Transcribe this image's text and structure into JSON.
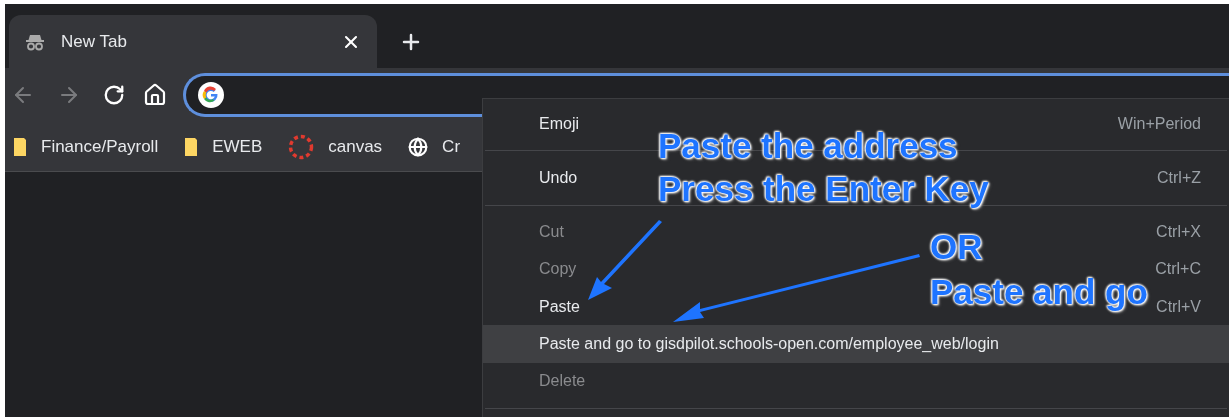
{
  "tab": {
    "title": "New Tab",
    "selected": true
  },
  "toolbar": {
    "back": {
      "disabled": true
    },
    "forward": {
      "disabled": true
    }
  },
  "address_bar": {
    "focused": true
  },
  "bookmarks": [
    {
      "label": "Finance/Payroll",
      "kind": "folder"
    },
    {
      "label": "EWEB",
      "kind": "folder"
    },
    {
      "label": "canvas",
      "kind": "canvas"
    },
    {
      "label": "Cr",
      "kind": "globe"
    }
  ],
  "context_menu": {
    "items": [
      {
        "kind": "item",
        "label": "Emoji",
        "shortcut": "Win+Period",
        "disabled": false,
        "selected": false
      },
      {
        "kind": "separator"
      },
      {
        "kind": "item",
        "label": "Undo",
        "shortcut": "Ctrl+Z",
        "disabled": false,
        "selected": false
      },
      {
        "kind": "separator"
      },
      {
        "kind": "item",
        "label": "Cut",
        "shortcut": "Ctrl+X",
        "disabled": true,
        "selected": false
      },
      {
        "kind": "item",
        "label": "Copy",
        "shortcut": "Ctrl+C",
        "disabled": true,
        "selected": false
      },
      {
        "kind": "item",
        "label": "Paste",
        "shortcut": "Ctrl+V",
        "disabled": false,
        "selected": false
      },
      {
        "kind": "item",
        "label": "Paste and go to gisdpilot.schools-open.com/employee_web/login",
        "disabled": false,
        "selected": true
      },
      {
        "kind": "item",
        "label": "Delete",
        "disabled": true,
        "selected": false
      },
      {
        "kind": "separator"
      }
    ]
  },
  "annotations": [
    {
      "lines": [
        "Paste the address",
        "Press the Enter Key"
      ]
    },
    {
      "lines": [
        "OR",
        "Paste and go"
      ]
    }
  ]
}
